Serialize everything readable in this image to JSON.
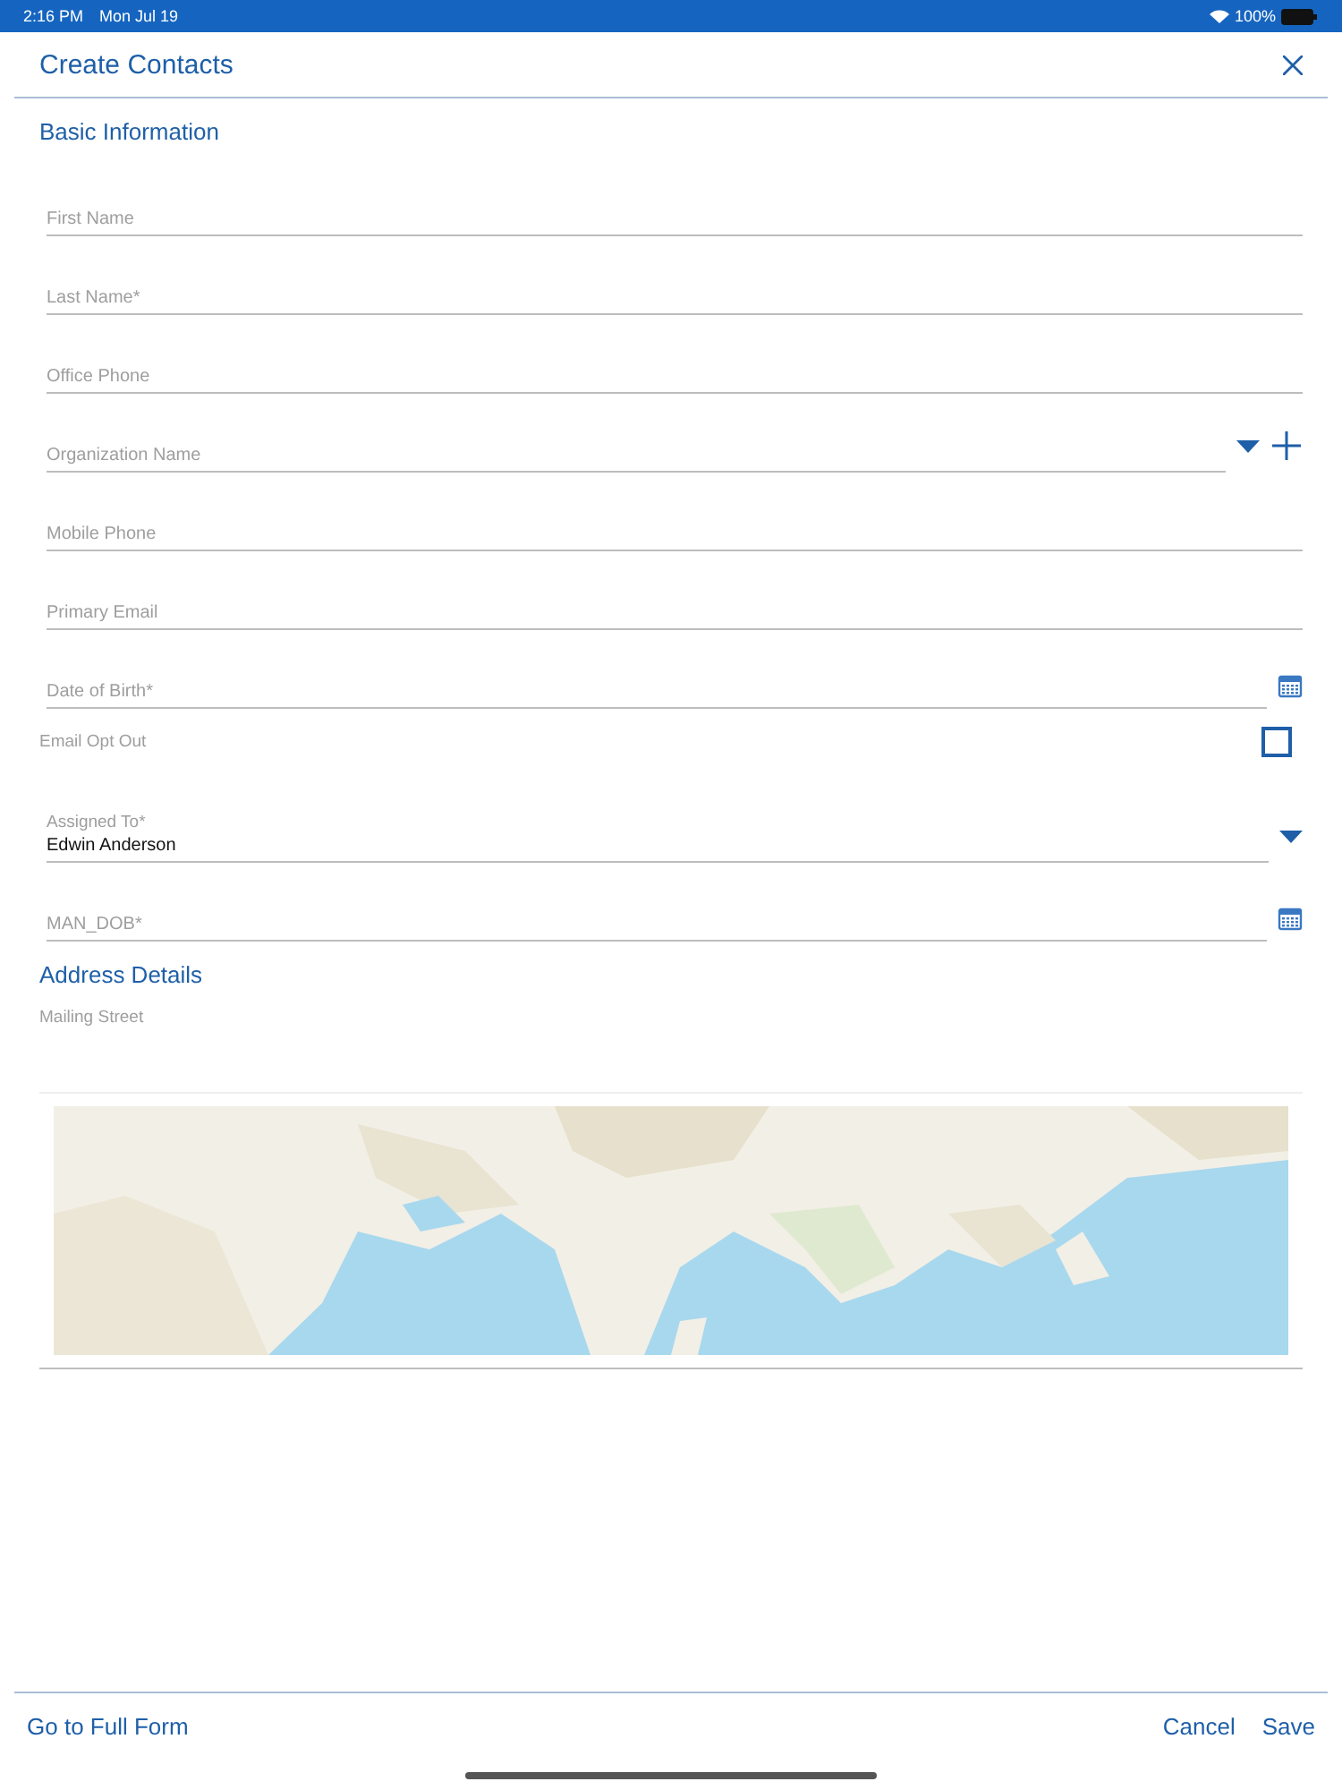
{
  "status_bar": {
    "time": "2:16 PM",
    "date": "Mon Jul 19",
    "battery": "100%"
  },
  "header": {
    "title": "Create Contacts"
  },
  "sections": [
    {
      "title": "Basic Information",
      "fields": [
        {
          "kind": "text",
          "placeholder": "First Name"
        },
        {
          "kind": "text",
          "placeholder": "Last Name*"
        },
        {
          "kind": "text",
          "placeholder": "Office Phone"
        },
        {
          "kind": "lookup",
          "placeholder": "Organization Name"
        },
        {
          "kind": "text",
          "placeholder": "Mobile Phone"
        },
        {
          "kind": "text",
          "placeholder": "Primary Email"
        },
        {
          "kind": "date",
          "placeholder": "Date of Birth*"
        },
        {
          "kind": "checkbox",
          "label": "Email Opt Out",
          "checked": false
        },
        {
          "kind": "select",
          "label": "Assigned To*",
          "value": "Edwin Anderson"
        },
        {
          "kind": "date",
          "placeholder": "MAN_DOB*"
        }
      ]
    },
    {
      "title": "Address Details",
      "fields": [
        {
          "kind": "textarea",
          "label": "Mailing Street"
        },
        {
          "kind": "map"
        }
      ]
    }
  ],
  "footer": {
    "left": "Go to Full Form",
    "buttons": [
      "Cancel",
      "Save"
    ]
  }
}
